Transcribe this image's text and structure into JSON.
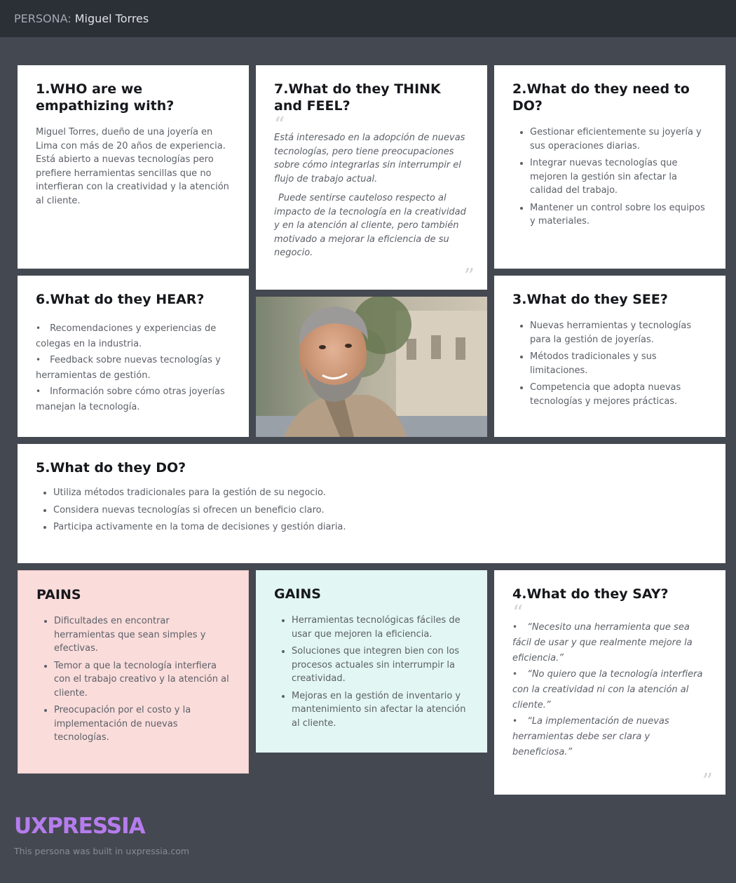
{
  "header": {
    "prefix": "PERSONA:",
    "name": "Miguel Torres"
  },
  "who": {
    "title": "1.WHO are we empathizing with?",
    "text": "Miguel Torres, dueño de una joyería en Lima con más de 20 años de experiencia. Está abierto a nuevas tecnologías pero prefiere herramientas sencillas que no interfieran con la creatividad y la atención al cliente."
  },
  "think": {
    "title": "7.What do they THINK and FEEL?",
    "paragraphs": [
      "Está interesado en la adopción de nuevas tecnologías, pero tiene preocupaciones sobre cómo integrarlas sin interrumpir el flujo de trabajo actual.",
      "Puede sentirse cauteloso respecto al impacto de la tecnología en la creatividad y en la atención al cliente, pero también motivado a mejorar la eficiencia de su negocio."
    ]
  },
  "need": {
    "title": "2.What do they need to DO?",
    "items": [
      "Gestionar eficientemente su joyería y sus operaciones diarias.",
      "Integrar nuevas tecnologías que mejoren la gestión sin afectar la calidad del trabajo.",
      "Mantener un control sobre los equipos y materiales."
    ]
  },
  "hear": {
    "title": "6.What do they HEAR?",
    "items": [
      "Recomendaciones y experiencias de colegas en la industria.",
      "Feedback sobre nuevas tecnologías y herramientas de gestión.",
      "Información sobre cómo otras joyerías manejan la tecnología."
    ]
  },
  "see": {
    "title": "3.What do they SEE?",
    "items": [
      "Nuevas herramientas y tecnologías para la gestión de joyerías.",
      "Métodos tradicionales y sus limitaciones.",
      "Competencia que adopta nuevas tecnologías y mejores prácticas."
    ]
  },
  "do": {
    "title": "5.What do they DO?",
    "items": [
      "Utiliza métodos tradicionales para la gestión de su negocio.",
      "Considera nuevas tecnologías si ofrecen un beneficio claro.",
      "Participa activamente en la toma de decisiones y gestión diaria."
    ]
  },
  "pains": {
    "title": "PAINS",
    "items": [
      "Dificultades en encontrar herramientas que sean simples y efectivas.",
      "Temor a que la tecnología interfiera con el trabajo creativo y la atención al cliente.",
      "Preocupación por el costo y la implementación de nuevas tecnologías."
    ]
  },
  "gains": {
    "title": "GAINS",
    "items": [
      "Herramientas tecnológicas fáciles de usar que mejoren la eficiencia.",
      "Soluciones que integren bien con los procesos actuales sin interrumpir la creatividad.",
      "Mejoras en la gestión de inventario y mantenimiento sin afectar la atención al cliente."
    ]
  },
  "say": {
    "title": "4.What do they SAY?",
    "items": [
      "“Necesito una herramienta que sea fácil de usar y que realmente mejore la eficiencia.”",
      "“No quiero que la tecnología interfiera con la creatividad ni con la atención al cliente.”",
      "“La implementación de nuevas herramientas debe ser clara y beneficiosa.”"
    ]
  },
  "footer": {
    "logo": "UXPRESSIA",
    "note": "This persona was built in uxpressia.com"
  },
  "colors": {
    "background": "#444850",
    "topbar": "#2b2f36",
    "pains": "#fadcdb",
    "gains": "#e2f6f3",
    "logo": "#b57ced"
  },
  "icons": {
    "quote_open": "quote-open-icon",
    "quote_close": "quote-close-icon"
  }
}
